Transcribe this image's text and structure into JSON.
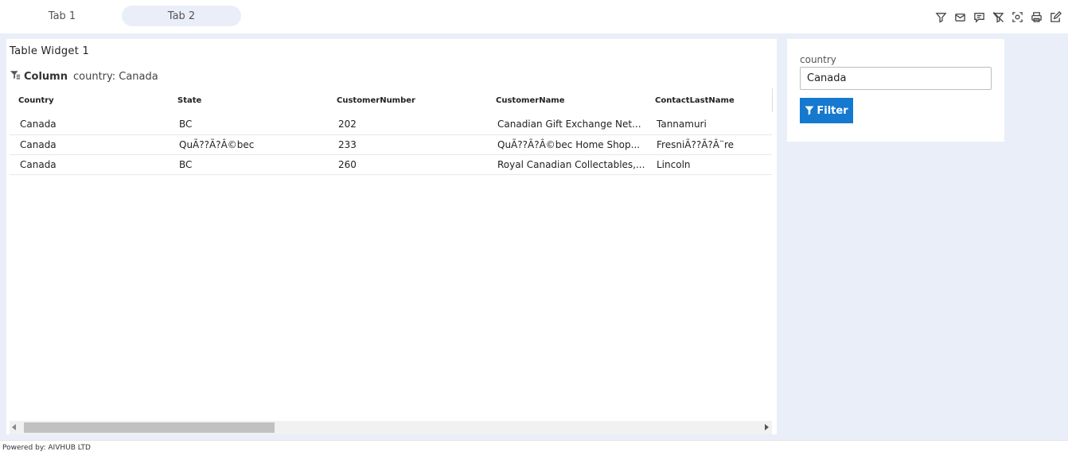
{
  "tabs": [
    {
      "label": "Tab 1",
      "active": false
    },
    {
      "label": "Tab 2",
      "active": true
    }
  ],
  "toolbar_icons": [
    "filter-icon",
    "mail-icon",
    "comment-icon",
    "clear-filter-icon",
    "screenshot-icon",
    "print-icon",
    "edit-icon"
  ],
  "table_widget": {
    "title": "Table Widget 1",
    "filter": {
      "label": "Column",
      "value": "country: Canada"
    },
    "columns": [
      "Country",
      "State",
      "CustomerNumber",
      "CustomerName",
      "ContactLastName"
    ],
    "rows": [
      [
        "Canada",
        "BC",
        "202",
        "Canadian Gift Exchange Net...",
        "Tannamuri"
      ],
      [
        "Canada",
        "QuÃ??Ã?Â©bec",
        "233",
        "QuÃ??Ã?Â©bec Home Shop...",
        "FresniÃ??Ã?Â¨re"
      ],
      [
        "Canada",
        "BC",
        "260",
        "Royal Canadian Collectables,...",
        "Lincoln"
      ]
    ]
  },
  "filter_widget": {
    "field_label": "country",
    "field_value": "Canada",
    "button_label": "Filter"
  },
  "footer": {
    "text": "Powered by: AIVHUB LTD"
  },
  "colors": {
    "workspace_bg": "#e9eef8",
    "active_tab_bg": "#e9eef8",
    "accent": "#1479cf"
  }
}
